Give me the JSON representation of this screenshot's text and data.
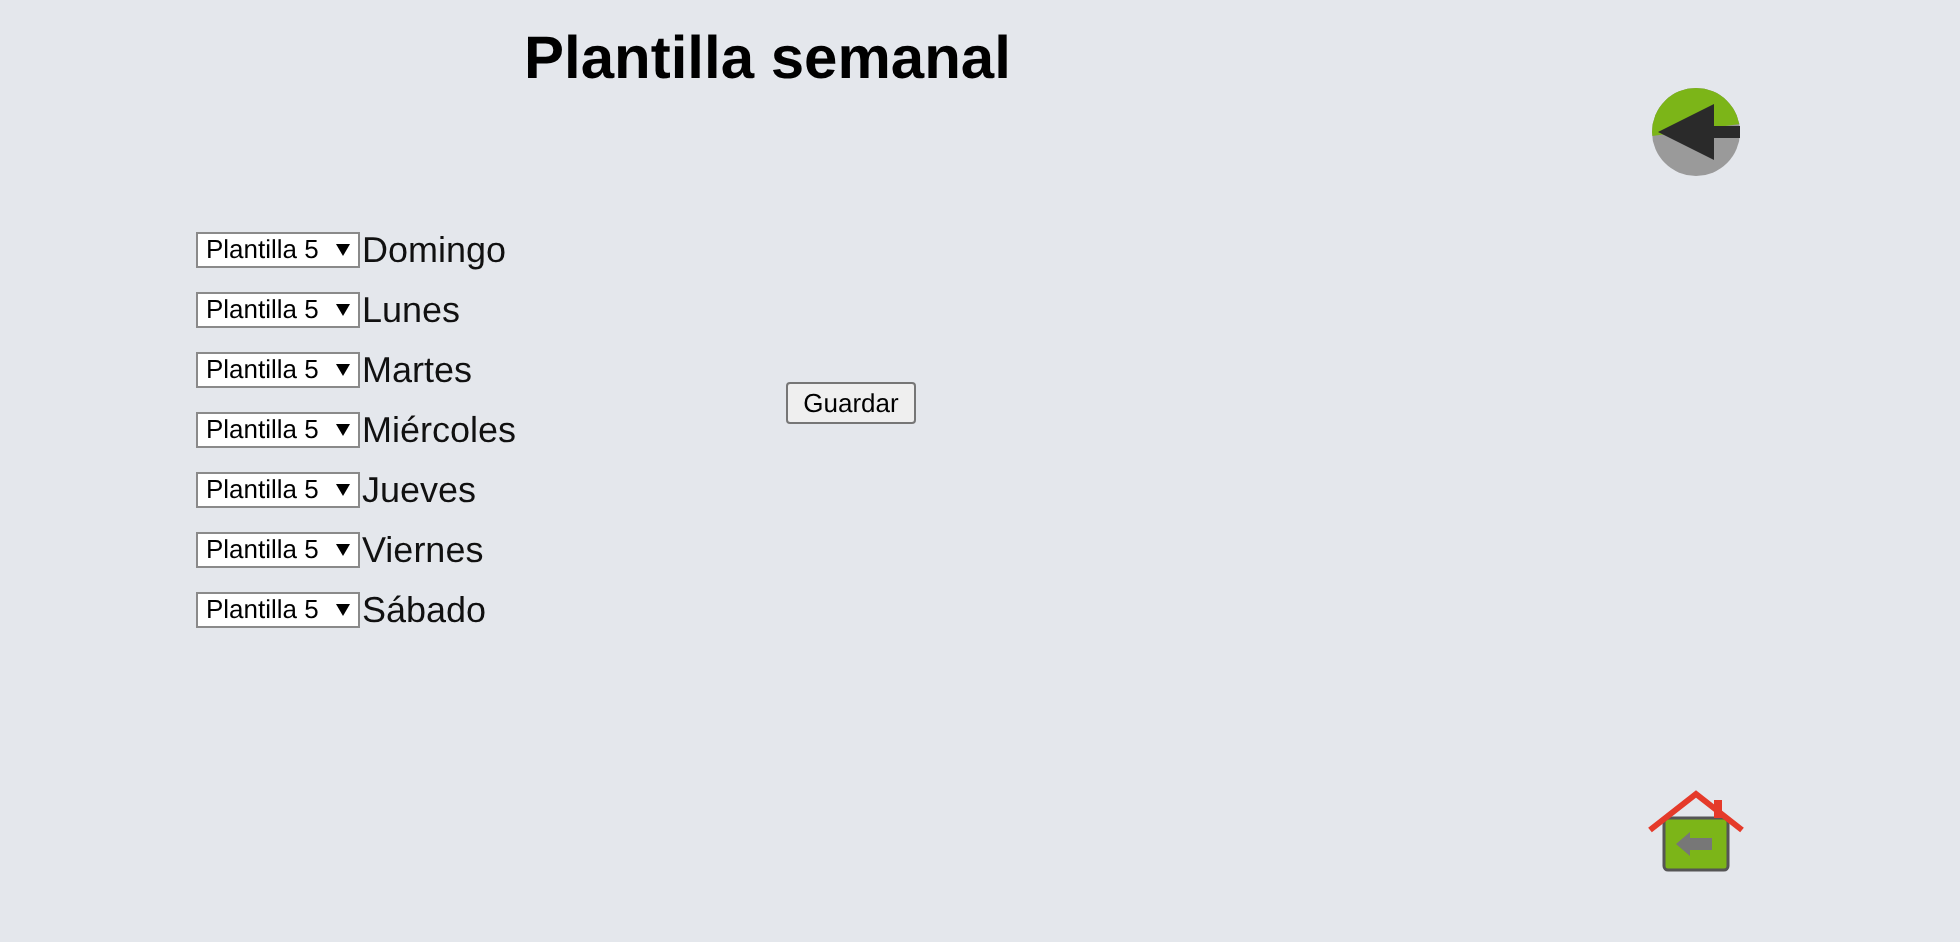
{
  "title": "Plantilla semanal",
  "days": [
    {
      "template": "Plantilla 5",
      "day": "Domingo"
    },
    {
      "template": "Plantilla 5",
      "day": "Lunes"
    },
    {
      "template": "Plantilla 5",
      "day": "Martes"
    },
    {
      "template": "Plantilla 5",
      "day": "Miércoles"
    },
    {
      "template": "Plantilla 5",
      "day": "Jueves"
    },
    {
      "template": "Plantilla 5",
      "day": "Viernes"
    },
    {
      "template": "Plantilla 5",
      "day": "Sábado"
    }
  ],
  "save_button": "Guardar"
}
